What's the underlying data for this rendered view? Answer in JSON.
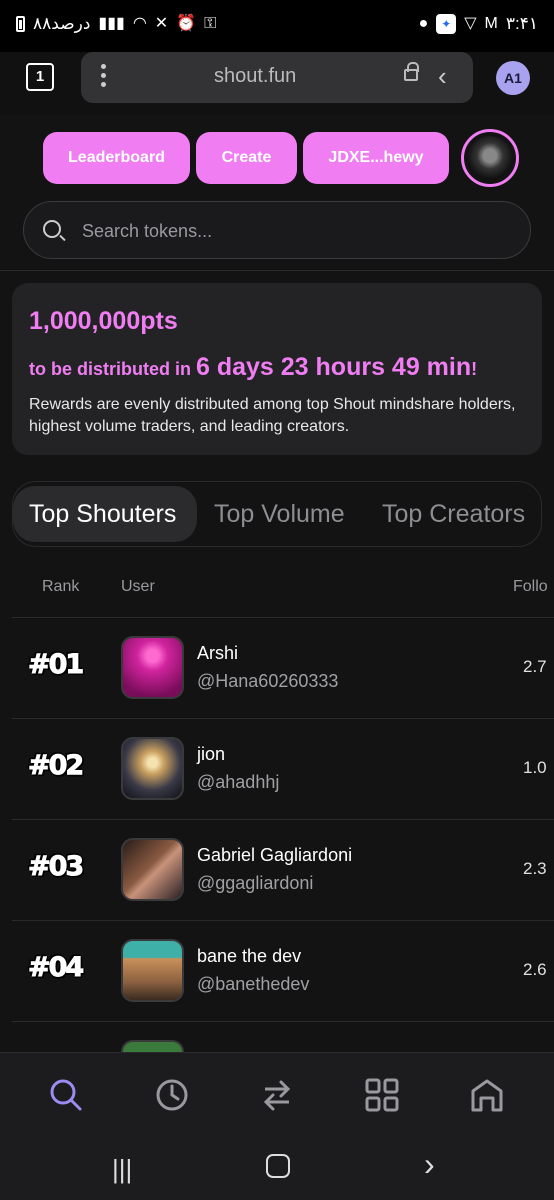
{
  "status_bar": {
    "left_text": "۸۸درصد",
    "time": "۳:۴۱"
  },
  "browser": {
    "tab_count": "1",
    "url": "shout.fun",
    "profile_initials": "A1"
  },
  "nav_pills": {
    "leaderboard": "Leaderboard",
    "create": "Create",
    "wallet": "JDXE...hewy"
  },
  "search": {
    "placeholder": "Search tokens..."
  },
  "rewards": {
    "points": "1,000,000pts",
    "distributed_prefix": "to be distributed in ",
    "countdown": "6 days 23 hours 49 min",
    "countdown_suffix": "!",
    "description": "Rewards are evenly distributed among top Shout mindshare holders, highest volume traders, and leading creators."
  },
  "tabs": [
    "Top Shouters",
    "Top Volume",
    "Top Creators"
  ],
  "table": {
    "headers": {
      "rank": "Rank",
      "user": "User",
      "followers": "Follo"
    },
    "rows": [
      {
        "rank": "#01",
        "name": "Arshi",
        "handle": "@Hana60260333",
        "followers": "2.7",
        "avatar_color": "#c0208f"
      },
      {
        "rank": "#02",
        "name": "jion",
        "handle": "@ahadhhj",
        "followers": "1.0",
        "avatar_color": "#3a4a5a"
      },
      {
        "rank": "#03",
        "name": "Gabriel Gagliardoni",
        "handle": "@ggagliardoni",
        "followers": "2.3",
        "avatar_color": "#5a3a2a"
      },
      {
        "rank": "#04",
        "name": "bane the dev",
        "handle": "@banethedev",
        "followers": "2.6",
        "avatar_color": "#8a6a4a"
      }
    ]
  },
  "bottom_nav": [
    "search-icon",
    "history-icon",
    "swap-icon",
    "grid-icon",
    "home-icon"
  ],
  "colors": {
    "accent": "#f07ef2",
    "active_nav": "#9c8cf0",
    "background": "#131313"
  }
}
